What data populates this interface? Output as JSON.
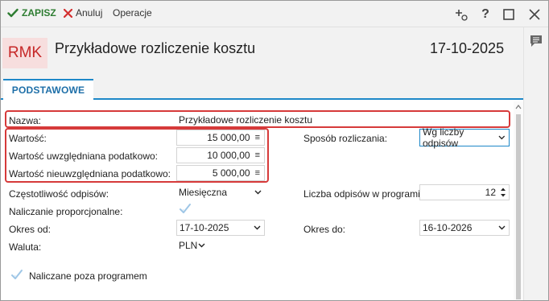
{
  "toolbar": {
    "save_label": "ZAPISZ",
    "cancel_label": "Anuluj",
    "operations_label": "Operacje",
    "icons": [
      "add-attachment-icon",
      "help-icon",
      "maximize-icon",
      "close-icon"
    ],
    "help_glyph": "?"
  },
  "header": {
    "badge": "RMK",
    "title": "Przykładowe rozliczenie kosztu",
    "date": "17-10-2025"
  },
  "tabs": [
    {
      "label": "PODSTAWOWE",
      "active": true
    }
  ],
  "form": {
    "nazwa_label": "Nazwa:",
    "nazwa_value": "Przykładowe rozliczenie kosztu",
    "wartosc_label": "Wartość:",
    "wartosc_value": "15 000,00",
    "wartosc_podatk_label": "Wartość uwzględniana podatkowo:",
    "wartosc_podatk_value": "10 000,00",
    "wartosc_niepodatk_label": "Wartość nieuwzględniana podatkowo:",
    "wartosc_niepodatk_value": "5 000,00",
    "sposob_label": "Sposób rozliczania:",
    "sposob_value": "Wg liczby odpisów",
    "czestotliwosc_label": "Częstotliwość odpisów:",
    "czestotliwosc_value": "Miesięczna",
    "liczba_label": "Liczba odpisów w programie:",
    "liczba_value": "12",
    "proporcjonalne_label": "Naliczanie proporcjonalne:",
    "proporcjonalne_checked": true,
    "okres_od_label": "Okres od:",
    "okres_od_value": "17-10-2025",
    "okres_do_label": "Okres do:",
    "okres_do_value": "16-10-2026",
    "waluta_label": "Waluta:",
    "waluta_value": "PLN",
    "poza_programem_label": "Naliczane poza programem",
    "poza_programem_checked": true,
    "menu_glyph": "≡"
  },
  "colors": {
    "accent": "#1e88c8",
    "save_green": "#2e7d32",
    "cancel_red": "#d32f2f",
    "highlight_red": "#d63a3a",
    "badge_bg": "#f7dede",
    "badge_text": "#c62828"
  }
}
